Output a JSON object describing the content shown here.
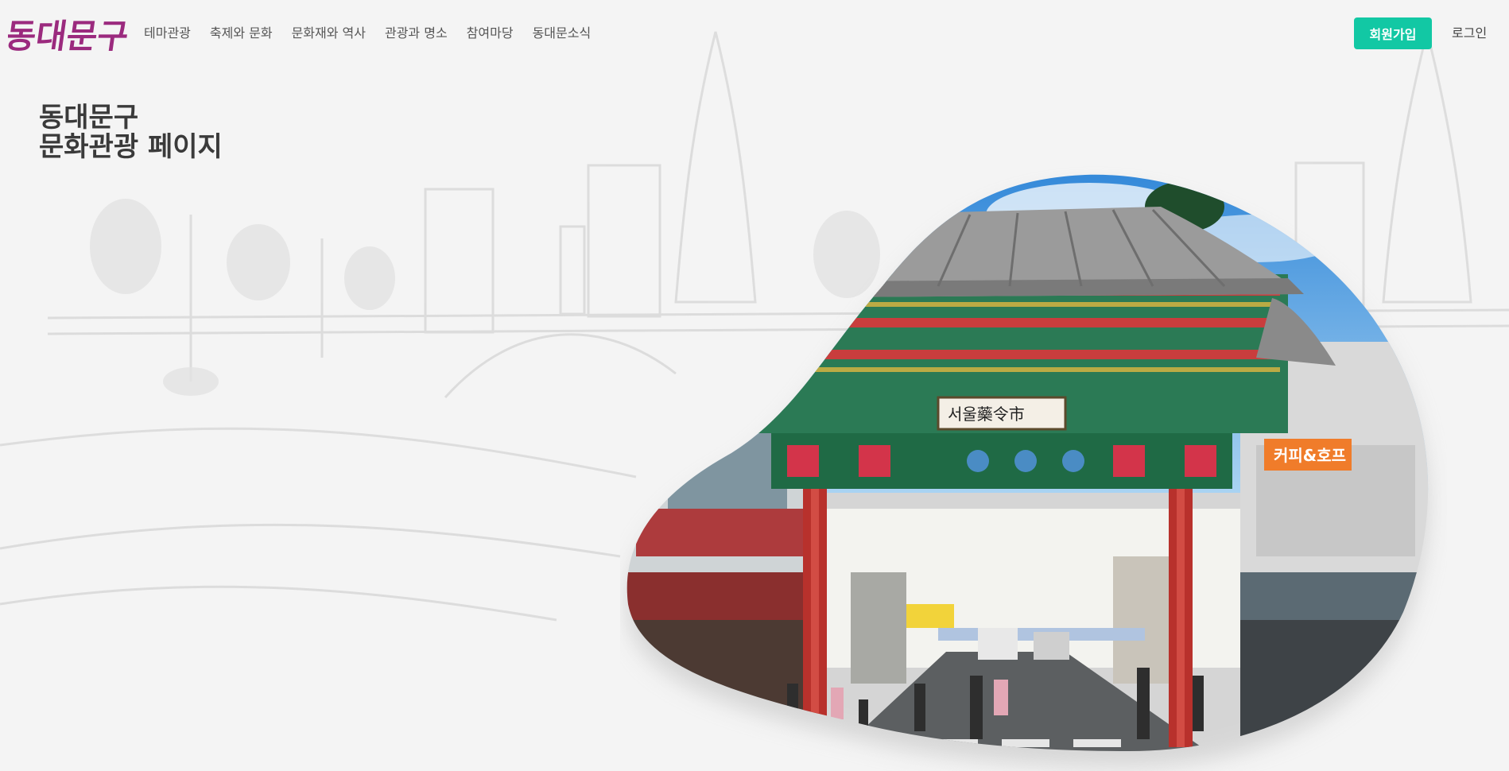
{
  "brand": {
    "logo_text": "동대문구",
    "logo_color": "#9b2a7e"
  },
  "nav": {
    "items": [
      {
        "label": "테마관광"
      },
      {
        "label": "축제와 문화"
      },
      {
        "label": "문화재와 역사"
      },
      {
        "label": "관광과 명소"
      },
      {
        "label": "참여마당"
      },
      {
        "label": "동대문소식"
      }
    ]
  },
  "auth": {
    "signup_label": "회원가입",
    "login_label": "로그인",
    "accent_color": "#12c8a4"
  },
  "hero": {
    "title_line1": "동대문구",
    "title_line2": "문화관광 페이지",
    "gate_sign": "서울藥令市",
    "cafe_sign": "커피&호프",
    "image_subject": "seoul-yangnyeongsi-gate"
  }
}
